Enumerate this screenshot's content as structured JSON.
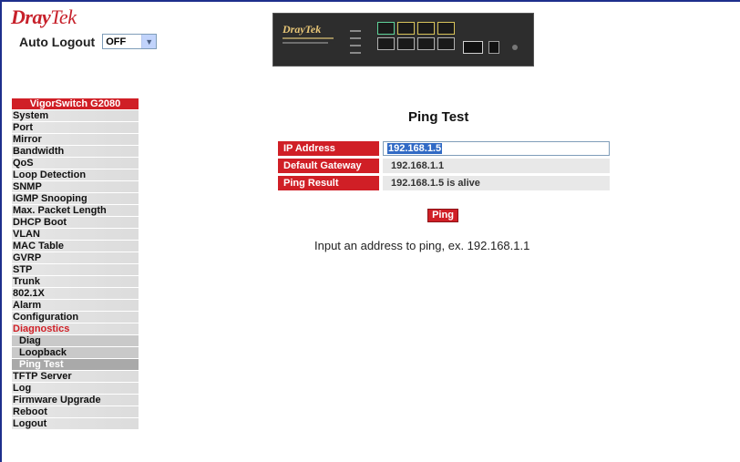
{
  "brand": {
    "name_part1": "Dray",
    "name_part2": "Tek"
  },
  "auto_logout": {
    "label": "Auto Logout",
    "value": "OFF"
  },
  "device_image": {
    "brand": "DrayTek"
  },
  "menu": {
    "title": "VigorSwitch G2080",
    "items": [
      {
        "label": "System"
      },
      {
        "label": "Port"
      },
      {
        "label": "Mirror"
      },
      {
        "label": "Bandwidth"
      },
      {
        "label": "QoS"
      },
      {
        "label": "Loop Detection"
      },
      {
        "label": "SNMP"
      },
      {
        "label": "IGMP Snooping"
      },
      {
        "label": "Max. Packet Length"
      },
      {
        "label": "DHCP Boot"
      },
      {
        "label": "VLAN"
      },
      {
        "label": "MAC Table"
      },
      {
        "label": "GVRP"
      },
      {
        "label": "STP"
      },
      {
        "label": "Trunk"
      },
      {
        "label": "802.1X"
      },
      {
        "label": "Alarm"
      },
      {
        "label": "Configuration"
      },
      {
        "label": "Diagnostics"
      },
      {
        "label": "Diag"
      },
      {
        "label": "Loopback"
      },
      {
        "label": "Ping Test"
      },
      {
        "label": "TFTP Server"
      },
      {
        "label": "Log"
      },
      {
        "label": "Firmware Upgrade"
      },
      {
        "label": "Reboot"
      },
      {
        "label": "Logout"
      }
    ]
  },
  "ping_test": {
    "title": "Ping Test",
    "ip_address_label": "IP Address",
    "ip_address_value": "192.168.1.5",
    "gateway_label": "Default Gateway",
    "gateway_value": "192.168.1.1",
    "result_label": "Ping Result",
    "result_value": "192.168.1.5 is alive",
    "button_label": "Ping",
    "hint": "Input an address to ping, ex. 192.168.1.1"
  },
  "colors": {
    "accent": "#d01f26",
    "frame": "#1e2f8c"
  }
}
